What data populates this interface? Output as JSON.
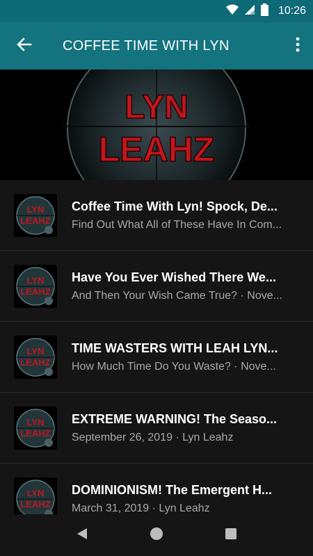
{
  "status_bar": {
    "time": "10:26",
    "icons": [
      "wifi-icon",
      "signal-icon",
      "battery-icon"
    ]
  },
  "app_bar": {
    "title": "COFFEE TIME WITH LYN",
    "back_icon": "arrow-back-icon",
    "menu_icon": "more-vert-icon"
  },
  "banner": {
    "line1": "LYN",
    "line2": "LEAHZ"
  },
  "thumbnail_text": {
    "line1": "LYN",
    "line2": "LEAHZ"
  },
  "episodes": [
    {
      "title": "Coffee Time With Lyn! Spock, De...",
      "subtitle": "Find Out What All of These Have In Com..."
    },
    {
      "title": "Have You Ever Wished There We...",
      "subtitle": "And Then Your Wish Came True? · Nove..."
    },
    {
      "title": "TIME WASTERS WITH LEAH LYN...",
      "subtitle": "How Much Time Do You Waste? · Nove..."
    },
    {
      "title": "EXTREME WARNING! The Seaso...",
      "subtitle": "September 26, 2019 · Lyn Leahz"
    },
    {
      "title": "DOMINIONISM! The Emergent H...",
      "subtitle": "March 31, 2019 · Lyn Leahz"
    }
  ],
  "nav_bar": {
    "back": "nav-back-icon",
    "home": "nav-home-icon",
    "recents": "nav-recents-icon"
  },
  "colors": {
    "status_bar": "#0e6a77",
    "app_bar": "#13737f",
    "background": "#151515",
    "logo_red": "#c0161e"
  }
}
